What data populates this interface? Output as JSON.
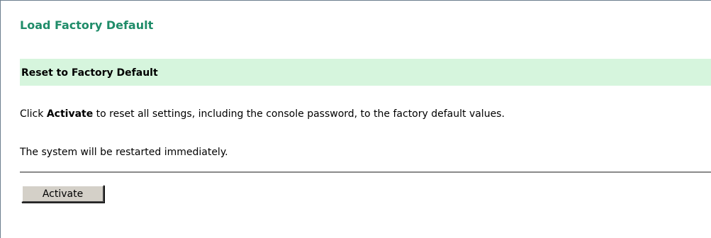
{
  "page": {
    "title": "Load Factory Default"
  },
  "section": {
    "title": "Reset to Factory Default"
  },
  "description": {
    "line1_prefix": "Click ",
    "line1_bold": "Activate",
    "line1_suffix": " to reset all settings, including the console password, to the factory default values.",
    "line2": "The system will be restarted immediately."
  },
  "actions": {
    "activate_label": "Activate"
  },
  "colors": {
    "title_green": "#1f8c69",
    "section_bg": "#d6f5dd",
    "button_face": "#d4d0c8"
  }
}
